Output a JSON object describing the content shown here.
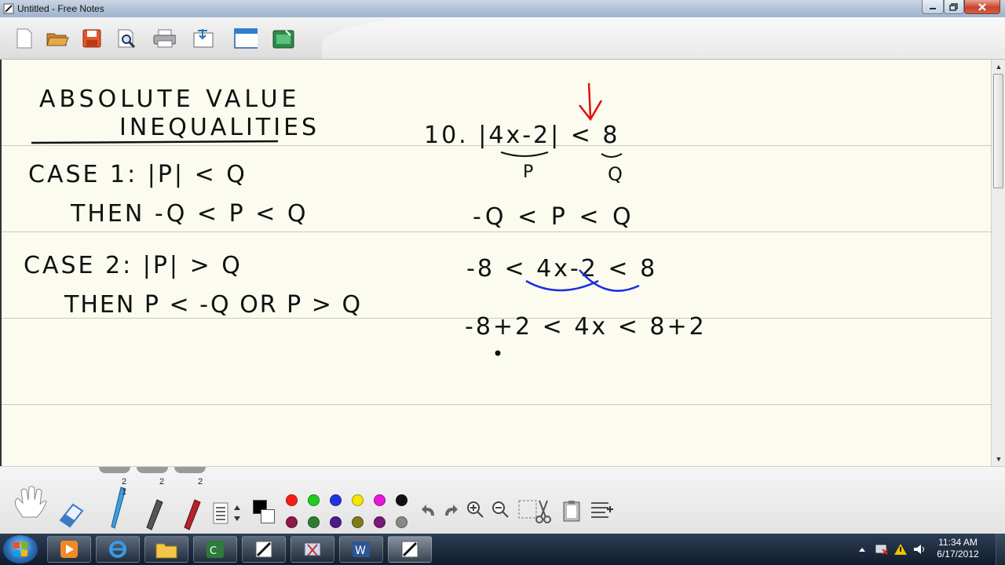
{
  "window": {
    "title": "Untitled - Free Notes"
  },
  "toolbar": {
    "buttons": [
      {
        "name": "new",
        "icon": "new-page-icon"
      },
      {
        "name": "open",
        "icon": "folder-open-icon"
      },
      {
        "name": "save",
        "icon": "save-disk-icon"
      },
      {
        "name": "preview",
        "icon": "print-preview-icon"
      },
      {
        "name": "print",
        "icon": "printer-icon"
      },
      {
        "name": "import",
        "icon": "import-icon"
      },
      {
        "name": "window",
        "icon": "window-icon"
      },
      {
        "name": "export",
        "icon": "export-icon"
      }
    ]
  },
  "tools": {
    "tab_counts": [
      "2",
      "2",
      "2"
    ],
    "pen_number": "1",
    "colors_top": [
      "#ff1a1a",
      "#22cc22",
      "#2233dd",
      "#f5e600",
      "#e61ad6",
      "#111111"
    ],
    "colors_bottom": [
      "#8b1a4a",
      "#2e7d32",
      "#4a1a8b",
      "#7d7a1a",
      "#7a1a7a",
      "#888888"
    ]
  },
  "notes": {
    "lines": [
      "ABSOLUTE VALUE",
      "INEQUALITIES",
      "CASE 1: |P| < Q",
      "THEN -Q < P < Q",
      "CASE 2: |P| > Q",
      "THEN P < -Q OR P > Q",
      "10. |4x-2| < 8",
      "P",
      "Q",
      "-Q < P < Q",
      "-8 < 4x-2 < 8",
      "-8+2 < 4x < 8+2"
    ]
  },
  "taskbar": {
    "clock_time": "11:34 AM",
    "clock_date": "6/17/2012",
    "apps": [
      "windows-media-icon",
      "internet-explorer-icon",
      "file-explorer-icon",
      "calculator-icon",
      "free-notes-icon",
      "snipping-icon",
      "word-icon",
      "free-notes-icon"
    ]
  }
}
